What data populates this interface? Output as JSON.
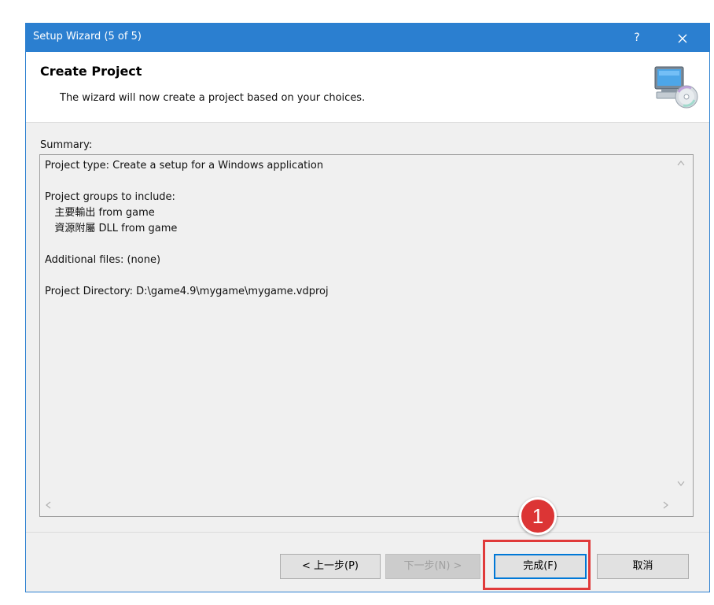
{
  "window": {
    "title": "Setup Wizard (5 of 5)",
    "help_label": "?",
    "close_label": "✕"
  },
  "header": {
    "heading": "Create Project",
    "subheading": "The wizard will now create a project based on your choices."
  },
  "summary": {
    "label": "Summary:",
    "text": "Project type: Create a setup for a Windows application\n\nProject groups to include:\n   主要輸出 from game\n   資源附屬 DLL from game\n\nAdditional files: (none)\n\nProject Directory: D:\\game4.9\\mygame\\mygame.vdproj"
  },
  "buttons": {
    "back": "< 上一步(P)",
    "next": "下一步(N) >",
    "finish": "完成(F)",
    "cancel": "取消"
  },
  "annotation": {
    "step_number": "1",
    "color": "#dc3535"
  },
  "colors": {
    "titlebar": "#2b7fd0",
    "focus_border": "#0078d7"
  },
  "icons": {
    "logo": "computer-cd-icon"
  }
}
